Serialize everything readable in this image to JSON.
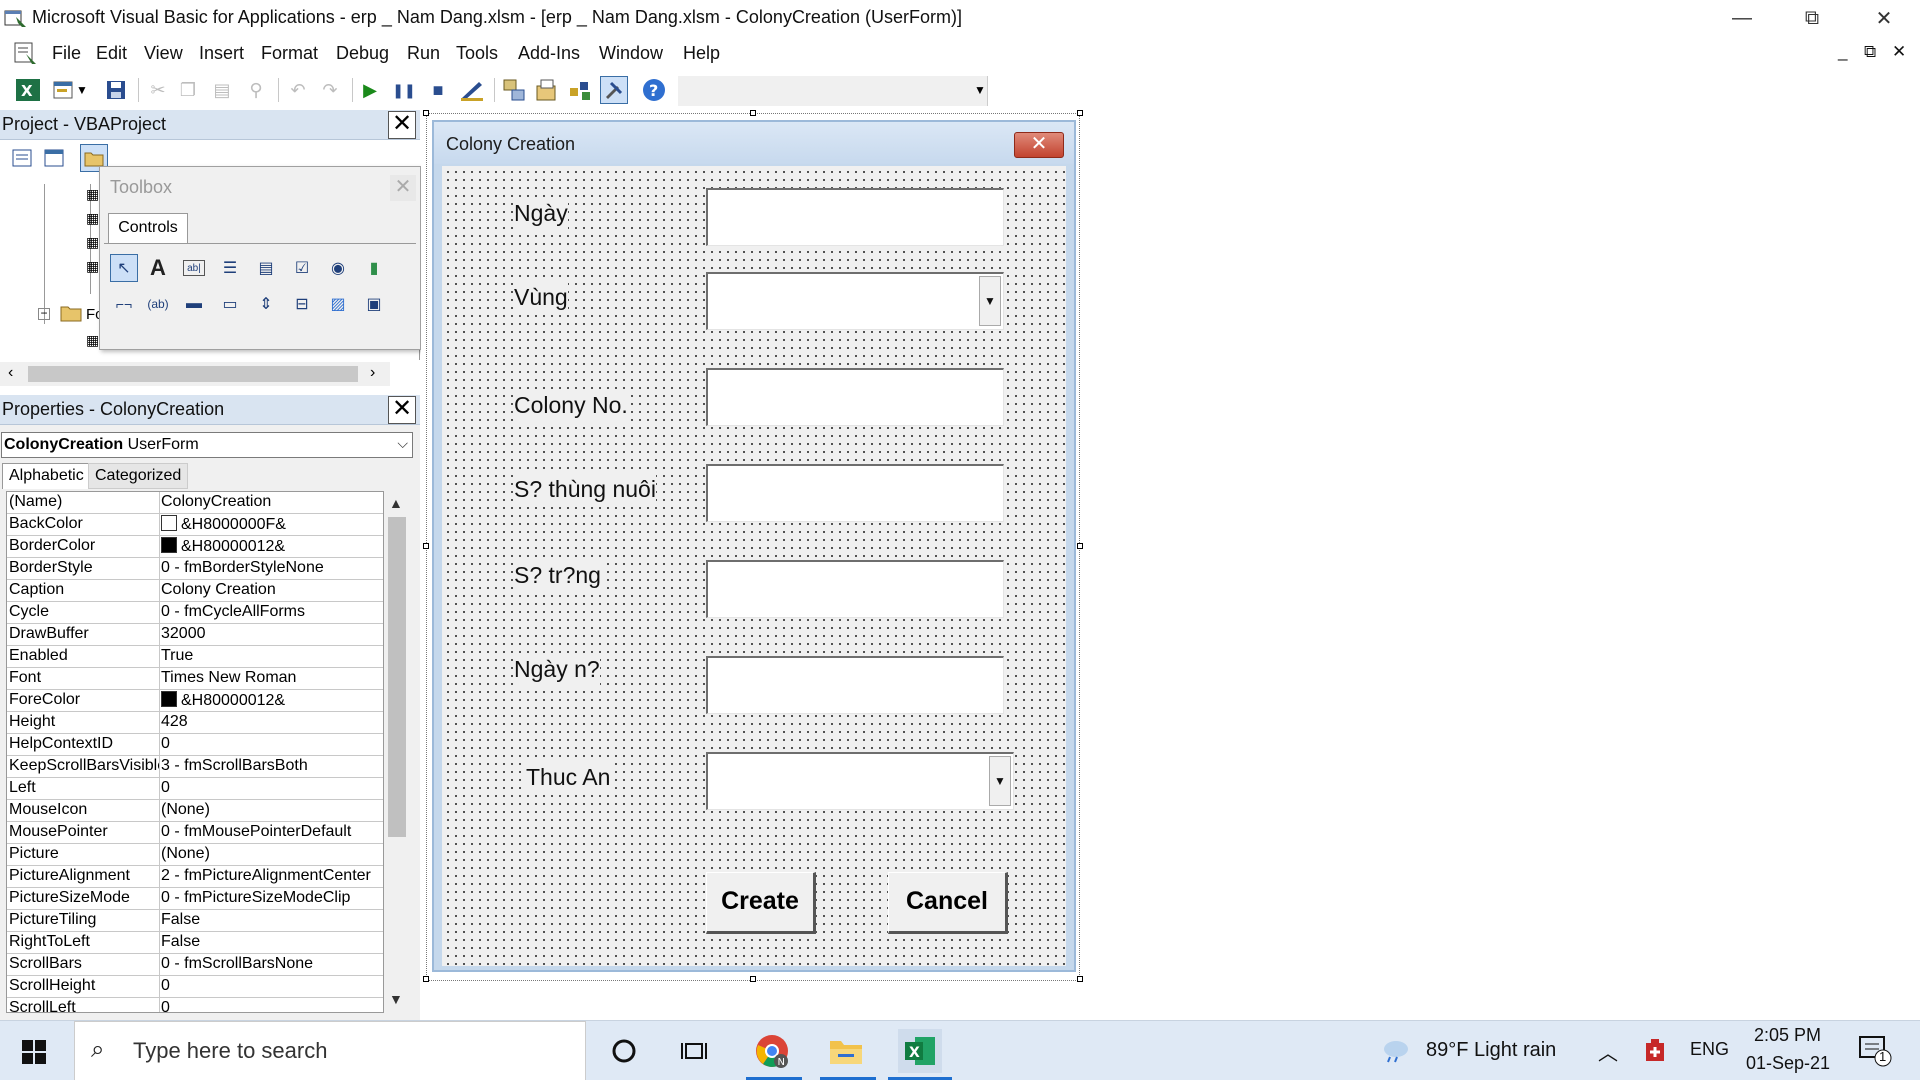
{
  "window": {
    "title": "Microsoft Visual Basic for Applications - erp _ Nam Dang.xlsm - [erp _ Nam Dang.xlsm - ColonyCreation (UserForm)]",
    "minimize": "—",
    "restore": "⧉",
    "close": "✕"
  },
  "menu": {
    "items": [
      "File",
      "Edit",
      "View",
      "Insert",
      "Format",
      "Debug",
      "Run",
      "Tools",
      "Add-Ins",
      "Window",
      "Help"
    ],
    "mdi_min": "_",
    "mdi_restore": "⧉",
    "mdi_close": "✕"
  },
  "toolbar": {
    "icons": [
      "excel-icon",
      "insert-userform-icon",
      "save-icon",
      "cut-icon",
      "copy-icon",
      "paste-icon",
      "find-icon",
      "undo-icon",
      "redo-icon",
      "run-icon",
      "break-icon",
      "reset-icon",
      "design-mode-icon",
      "project-explorer-icon",
      "properties-icon",
      "object-browser-icon",
      "toolbox-icon",
      "help-icon"
    ]
  },
  "project": {
    "title": "Project - VBAProject",
    "close": "✕",
    "tree_partial_label": "Fo"
  },
  "toolbox": {
    "title": "Toolbox",
    "close": "✕",
    "tab": "Controls"
  },
  "properties": {
    "title": "Properties - ColonyCreation",
    "close": "✕",
    "object_name": "ColonyCreation",
    "object_type": "UserForm",
    "tabs": [
      "Alphabetic",
      "Categorized"
    ],
    "rows": [
      {
        "name": "(Name)",
        "value": "ColonyCreation"
      },
      {
        "name": "BackColor",
        "value": "&H8000000F&",
        "swatch": "#ffffff"
      },
      {
        "name": "BorderColor",
        "value": "&H80000012&",
        "swatch": "#000000"
      },
      {
        "name": "BorderStyle",
        "value": "0 - fmBorderStyleNone"
      },
      {
        "name": "Caption",
        "value": "Colony Creation"
      },
      {
        "name": "Cycle",
        "value": "0 - fmCycleAllForms"
      },
      {
        "name": "DrawBuffer",
        "value": "32000"
      },
      {
        "name": "Enabled",
        "value": "True"
      },
      {
        "name": "Font",
        "value": "Times New Roman"
      },
      {
        "name": "ForeColor",
        "value": "&H80000012&",
        "swatch": "#000000"
      },
      {
        "name": "Height",
        "value": "428"
      },
      {
        "name": "HelpContextID",
        "value": "0"
      },
      {
        "name": "KeepScrollBarsVisible",
        "value": "3 - fmScrollBarsBoth"
      },
      {
        "name": "Left",
        "value": "0"
      },
      {
        "name": "MouseIcon",
        "value": "(None)"
      },
      {
        "name": "MousePointer",
        "value": "0 - fmMousePointerDefault"
      },
      {
        "name": "Picture",
        "value": "(None)"
      },
      {
        "name": "PictureAlignment",
        "value": "2 - fmPictureAlignmentCenter"
      },
      {
        "name": "PictureSizeMode",
        "value": "0 - fmPictureSizeModeClip"
      },
      {
        "name": "PictureTiling",
        "value": "False"
      },
      {
        "name": "RightToLeft",
        "value": "False"
      },
      {
        "name": "ScrollBars",
        "value": "0 - fmScrollBarsNone"
      },
      {
        "name": "ScrollHeight",
        "value": "0"
      },
      {
        "name": "ScrollLeft",
        "value": "0"
      }
    ]
  },
  "userform": {
    "caption": "Colony Creation",
    "close": "✕",
    "labels": {
      "ngay": "Ngày",
      "vung": "Vùng",
      "colony_no": "Colony No.",
      "so_thung_nuoi": "S? thùng nuôi",
      "so_trung": "S? tr?ng",
      "ngay_no": "Ngày n?",
      "thuc_an": "Thuc An"
    },
    "buttons": {
      "create": "Create",
      "cancel": "Cancel"
    }
  },
  "taskbar": {
    "search_placeholder": "Type here to search",
    "weather": "89°F  Light rain",
    "language": "ENG",
    "time": "2:05 PM",
    "date": "01-Sep-21",
    "notification_count": "1"
  },
  "colors": {
    "panel_header": "#d9e4f1",
    "form_frame": "#c5d8ec",
    "close_button": "#c2432f",
    "taskbar": "#dfe9f5"
  }
}
